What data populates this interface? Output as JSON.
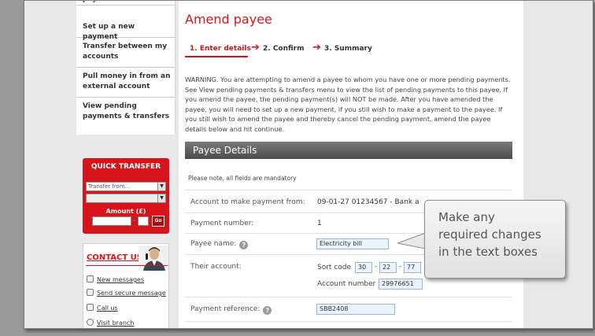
{
  "nav": {
    "partial_item": "payees",
    "items": [
      {
        "label": "Set up a new payment"
      },
      {
        "label": "Transfer between my accounts"
      },
      {
        "label": "Pull money in from an external account"
      },
      {
        "label": "View pending payments & transfers"
      }
    ]
  },
  "quick_transfer": {
    "title": "QUICK TRANSFER",
    "transfer_from": "Transfer from...",
    "amount_label": "Amount (£)",
    "decimal": ".",
    "go_label": "Go"
  },
  "contact": {
    "title": "CONTACT US",
    "items": [
      {
        "label": "New messages",
        "icon": "mail-icon"
      },
      {
        "label": "Send secure message",
        "icon": "send-message-icon"
      },
      {
        "label": "Call us",
        "icon": "phone-icon"
      },
      {
        "label": "Visit branch",
        "icon": "branch-icon"
      }
    ]
  },
  "main": {
    "title": "Amend payee",
    "steps": [
      {
        "label": "1. Enter details"
      },
      {
        "label": "2. Confirm"
      },
      {
        "label": "3. Summary"
      }
    ],
    "warning": "WARNING. You are attempting to amend a payee to whom you have one or more pending payments. See View pending payments & transfers menu to view the list of pending payments to this payee. If you amend the payee, the pending payment(s) will NOT be made. After you have amended the payee, you will need to set up a new payment, if you still wish to make a payment to the payee. If you still wish to amend the payee and thereby cancel the pending payment, amend the payee details below and hit continue.",
    "section_title": "Payee Details",
    "mandatory_note": "Please note, all fields are mandatory",
    "fields": {
      "account_label": "Account to make payment from:",
      "account_value": "09-01-27 01234567 - Bank a",
      "payment_number_label": "Payment number:",
      "payment_number_value": "1",
      "payee_name_label": "Payee name:",
      "payee_name_value": "Electricity bill",
      "their_account_label": "Their account:",
      "sort_code_label": "Sort code",
      "sort_code": [
        "30",
        "22",
        "77"
      ],
      "account_number_label": "Account number",
      "account_number_value": "29976651",
      "payment_reference_label": "Payment reference:",
      "payment_reference_value": "SBB2408",
      "dash": "-",
      "help_glyph": "?"
    }
  },
  "callout": {
    "lines": [
      "Make any",
      "required changes",
      "in the text boxes"
    ]
  },
  "colors": {
    "brand_red": "#d8141a",
    "field_bg": "#eaf3fb"
  }
}
